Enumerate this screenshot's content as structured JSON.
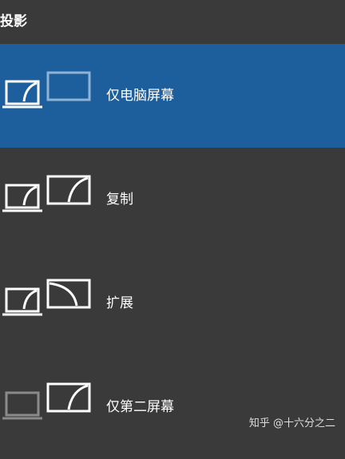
{
  "header": {
    "title": "投影"
  },
  "options": [
    {
      "label": "仅电脑屏幕",
      "selected": true,
      "icon": "pc-screen-only-icon"
    },
    {
      "label": "复制",
      "selected": false,
      "icon": "duplicate-icon"
    },
    {
      "label": "扩展",
      "selected": false,
      "icon": "extend-icon"
    },
    {
      "label": "仅第二屏幕",
      "selected": false,
      "icon": "second-screen-only-icon"
    }
  ],
  "watermark": {
    "text": "知乎 @十六分之二"
  },
  "colors": {
    "background": "#3a3a3a",
    "selected": "#1c5f9c",
    "icon_white": "#ffffff",
    "icon_dim": "#8a8a8a",
    "icon_dim_blue": "#8fb3d4"
  }
}
